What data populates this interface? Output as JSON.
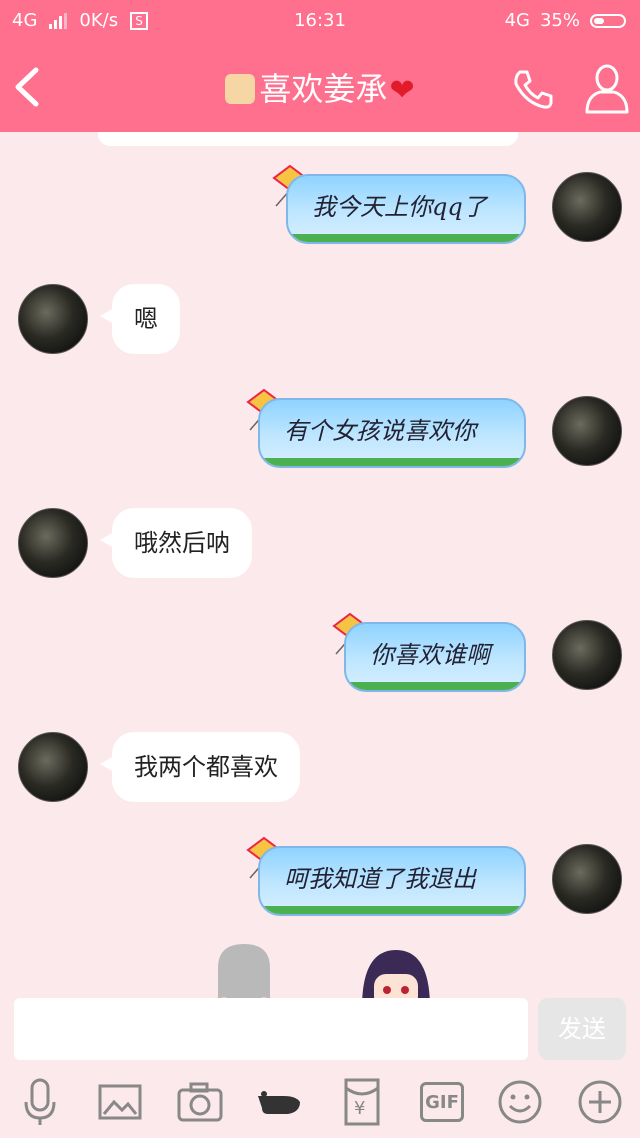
{
  "status_bar": {
    "network": "4G",
    "speed": "0K/s",
    "app_badge": "S",
    "time": "16:31",
    "network_right": "4G",
    "battery": "35%"
  },
  "header": {
    "title": "喜欢姜承",
    "title_icons": [
      "thumbs-up-icon",
      "heart-icon"
    ],
    "actions": [
      "phone-icon",
      "profile-icon"
    ]
  },
  "messages": [
    {
      "side": "right",
      "text": "我今天上你qq了"
    },
    {
      "side": "left",
      "text": "嗯"
    },
    {
      "side": "right",
      "text": "有个女孩说喜欢你"
    },
    {
      "side": "left",
      "text": "哦然后呐"
    },
    {
      "side": "right",
      "text": "你喜欢谁啊"
    },
    {
      "side": "left",
      "text": "我两个都喜欢"
    },
    {
      "side": "right",
      "text": "呵我知道了我退出"
    }
  ],
  "composer": {
    "input_value": "",
    "send_label": "发送"
  },
  "toolbar": {
    "items": [
      "microphone-icon",
      "image-icon",
      "camera-icon",
      "poke-icon",
      "red-packet-icon",
      "gif-icon",
      "emoji-icon",
      "plus-icon"
    ],
    "gif_label": "GIF",
    "yen_label": "¥"
  },
  "colors": {
    "header_bg": "#ff6f8e",
    "chat_bg": "#fbe9ec",
    "right_bubble": "#8fd3ff",
    "left_bubble": "#ffffff"
  }
}
